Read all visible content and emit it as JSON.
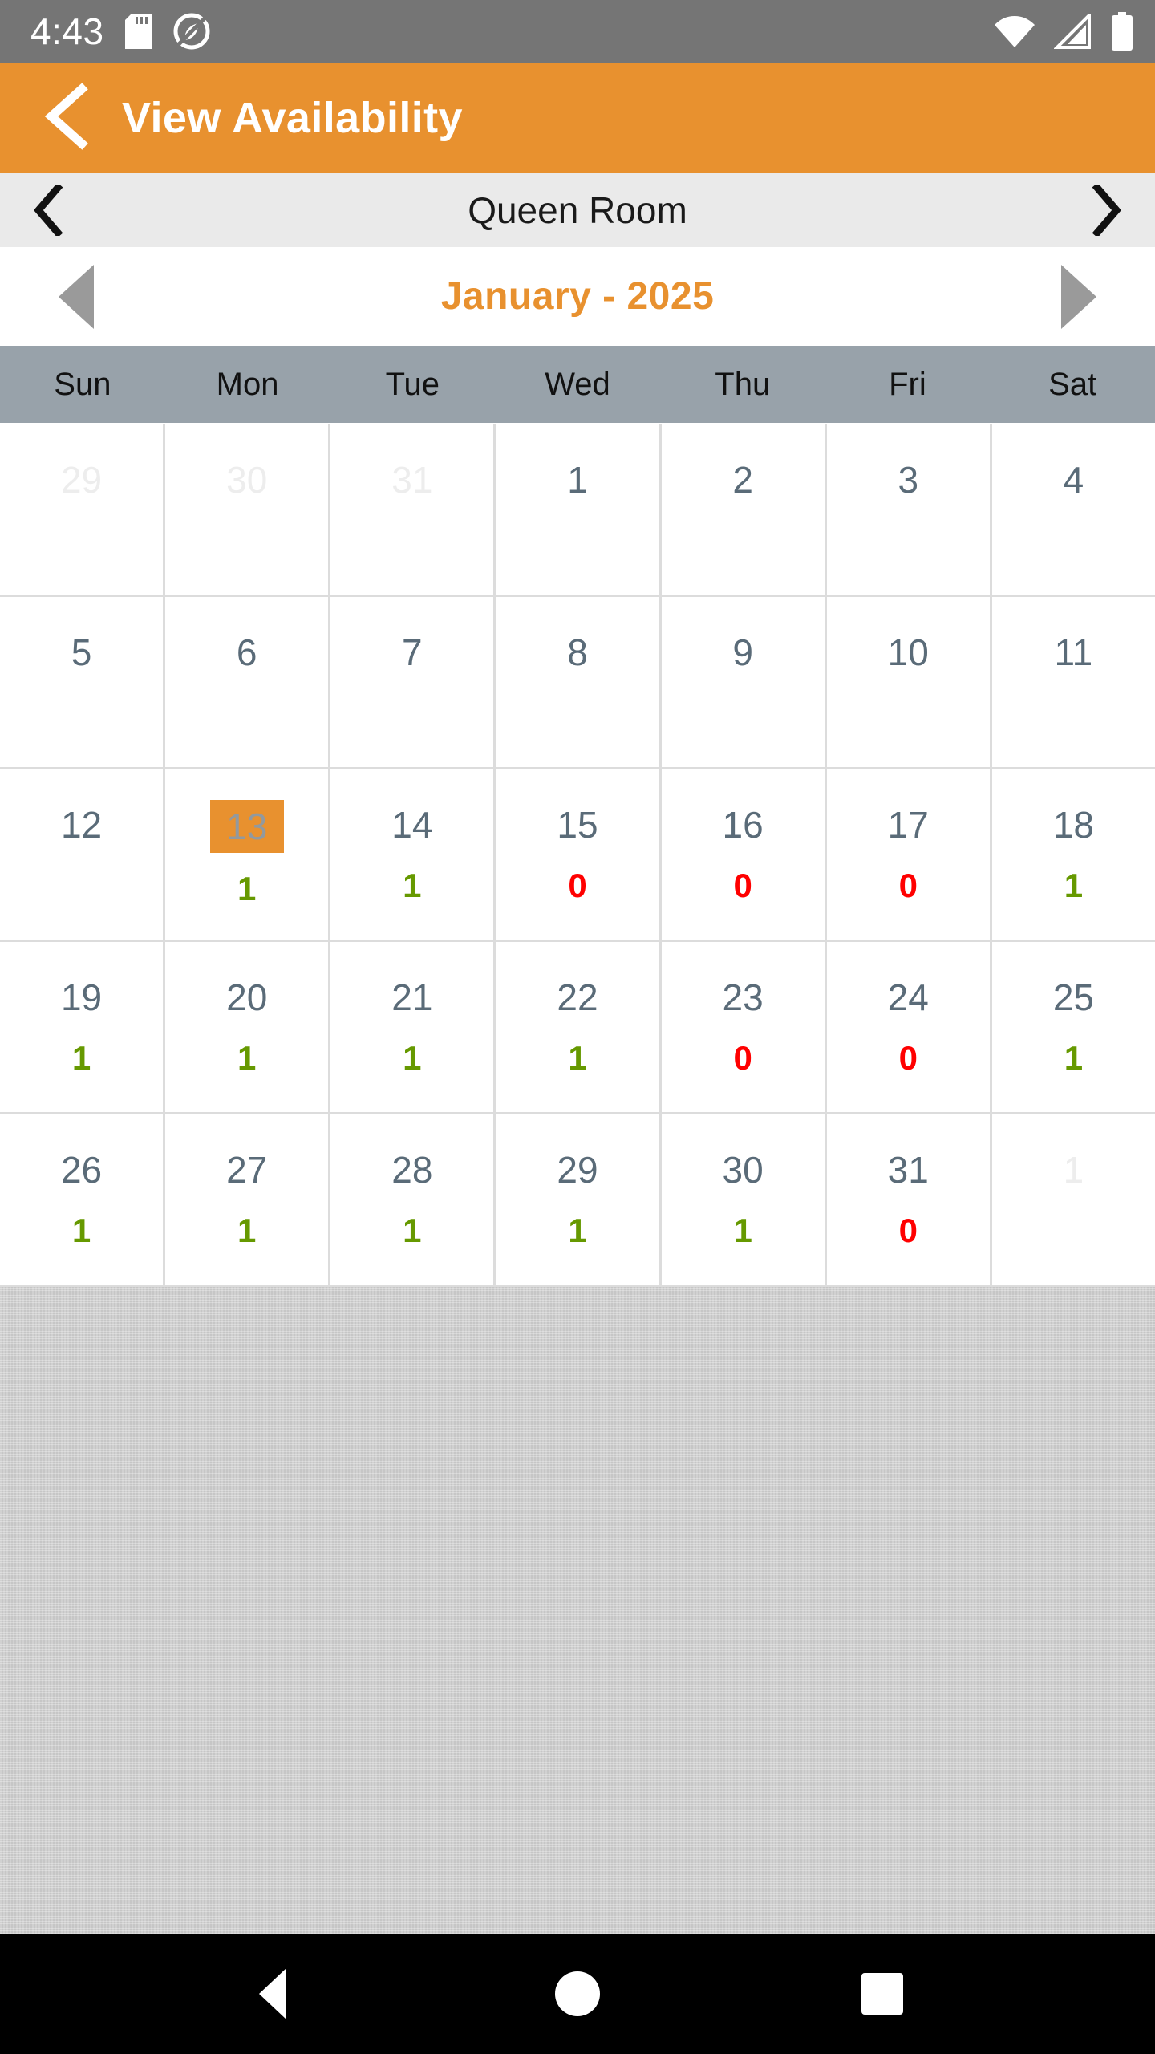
{
  "status_bar": {
    "time": "4:43",
    "left_icons": [
      "sd-card-icon",
      "privacy-shield-icon"
    ],
    "right_icons": [
      "wifi-icon",
      "cellular-signal-icon",
      "battery-icon"
    ],
    "background_color": "#757575"
  },
  "app_bar": {
    "back_icon": "chevron-left-icon",
    "title": "View Availability",
    "background_color": "#E8912F",
    "text_color": "#FFFFFF"
  },
  "room_selector": {
    "prev_icon": "chevron-left-icon",
    "next_icon": "chevron-right-icon",
    "room_name": "Queen Room",
    "background_color": "#EAEAEA"
  },
  "month_nav": {
    "prev_icon": "triangle-left-icon",
    "next_icon": "triangle-right-icon",
    "label": "January - 2025",
    "accent_color": "#E8912F",
    "arrow_color": "#9A9A9A"
  },
  "calendar": {
    "weekdays": [
      "Sun",
      "Mon",
      "Tue",
      "Wed",
      "Thu",
      "Fri",
      "Sat"
    ],
    "weekday_bg": "#98A2AA",
    "selected_day": 13,
    "selected_bg": "#E8912F",
    "available_color": "#669900",
    "unavailable_color": "#FF0000",
    "weeks": [
      [
        {
          "day": "29",
          "muted": true,
          "avail": null
        },
        {
          "day": "30",
          "muted": true,
          "avail": null
        },
        {
          "day": "31",
          "muted": true,
          "avail": null
        },
        {
          "day": "1",
          "muted": false,
          "avail": null
        },
        {
          "day": "2",
          "muted": false,
          "avail": null
        },
        {
          "day": "3",
          "muted": false,
          "avail": null
        },
        {
          "day": "4",
          "muted": false,
          "avail": null
        }
      ],
      [
        {
          "day": "5",
          "muted": false,
          "avail": null
        },
        {
          "day": "6",
          "muted": false,
          "avail": null
        },
        {
          "day": "7",
          "muted": false,
          "avail": null
        },
        {
          "day": "8",
          "muted": false,
          "avail": null
        },
        {
          "day": "9",
          "muted": false,
          "avail": null
        },
        {
          "day": "10",
          "muted": false,
          "avail": null
        },
        {
          "day": "11",
          "muted": false,
          "avail": null
        }
      ],
      [
        {
          "day": "12",
          "muted": false,
          "avail": null
        },
        {
          "day": "13",
          "muted": false,
          "avail": "1",
          "selected": true
        },
        {
          "day": "14",
          "muted": false,
          "avail": "1"
        },
        {
          "day": "15",
          "muted": false,
          "avail": "0"
        },
        {
          "day": "16",
          "muted": false,
          "avail": "0"
        },
        {
          "day": "17",
          "muted": false,
          "avail": "0"
        },
        {
          "day": "18",
          "muted": false,
          "avail": "1"
        }
      ],
      [
        {
          "day": "19",
          "muted": false,
          "avail": "1"
        },
        {
          "day": "20",
          "muted": false,
          "avail": "1"
        },
        {
          "day": "21",
          "muted": false,
          "avail": "1"
        },
        {
          "day": "22",
          "muted": false,
          "avail": "1"
        },
        {
          "day": "23",
          "muted": false,
          "avail": "0"
        },
        {
          "day": "24",
          "muted": false,
          "avail": "0"
        },
        {
          "day": "25",
          "muted": false,
          "avail": "1"
        }
      ],
      [
        {
          "day": "26",
          "muted": false,
          "avail": "1"
        },
        {
          "day": "27",
          "muted": false,
          "avail": "1"
        },
        {
          "day": "28",
          "muted": false,
          "avail": "1"
        },
        {
          "day": "29",
          "muted": false,
          "avail": "1"
        },
        {
          "day": "30",
          "muted": false,
          "avail": "1"
        },
        {
          "day": "31",
          "muted": false,
          "avail": "0"
        },
        {
          "day": "1",
          "muted": true,
          "avail": null
        }
      ]
    ]
  },
  "nav_bar": {
    "back_icon": "triangle-back-icon",
    "home_icon": "circle-home-icon",
    "recents_icon": "square-recents-icon",
    "background_color": "#000000"
  }
}
